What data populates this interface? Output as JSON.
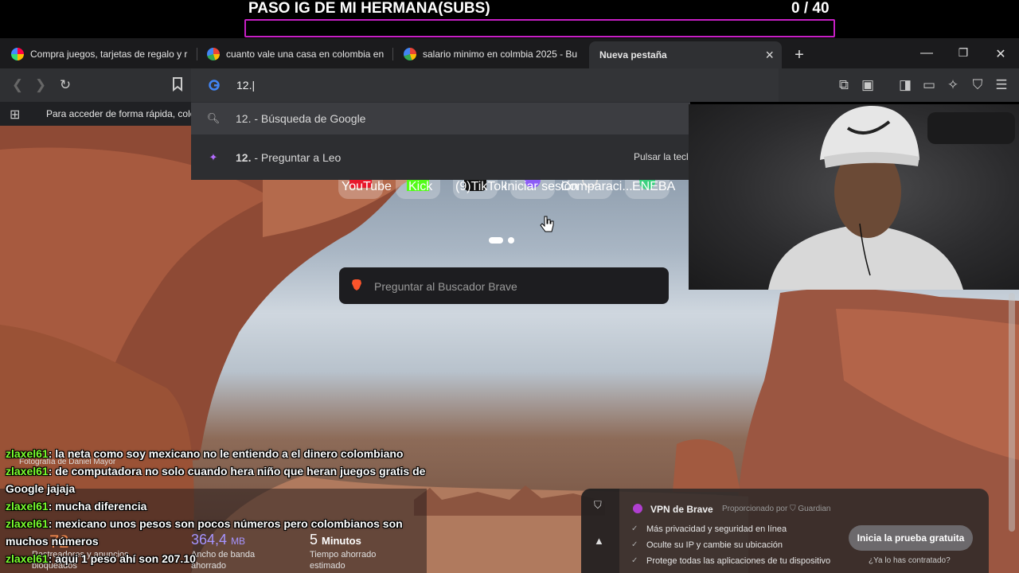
{
  "stream_goal": {
    "title": "PASO IG DE MI HERMANA(SUBS)",
    "count": "0  / 40",
    "progress": 0
  },
  "tabs": [
    {
      "title": "Compra juegos, tarjetas de regalo y r",
      "favicon": "eneba-icon"
    },
    {
      "title": "cuanto vale una casa en colombia en",
      "favicon": "google-icon"
    },
    {
      "title": "salario minimo en colmbia 2025 - Bu",
      "favicon": "google-icon"
    },
    {
      "title": "Nueva pestaña",
      "close": "×",
      "active": true
    }
  ],
  "new_tab_label": "+",
  "window_controls": {
    "minimize": "—",
    "restore": "❐",
    "close": "✕"
  },
  "omnibox": {
    "text": "12.|"
  },
  "bookmark_bar": {
    "text": "Para acceder de forma rápida, colo"
  },
  "suggestions": [
    {
      "bold": "12.",
      "rest": " - Búsqueda de Google",
      "icon": "search-icon"
    },
    {
      "bold": "12.",
      "rest": " - Preguntar a Leo",
      "icon": "leo-icon",
      "hint": "Pulsar la tecla"
    }
  ],
  "top_sites": [
    {
      "label": "YouTube",
      "color": "#e8172b"
    },
    {
      "label": "Kick",
      "color": "#53fc18"
    },
    {
      "label": "(9)TikTok",
      "color": "#111111"
    },
    {
      "label": "Iniciar sesión",
      "color": "#8b5cf6"
    },
    {
      "label": "Comparaci...",
      "color": "#cfcfcf"
    },
    {
      "label": "ENEBA",
      "color": "#3bd17f"
    }
  ],
  "search": {
    "placeholder": "Preguntar al Buscador Brave"
  },
  "photo_credit": "Fotografía de Daniel Mayor",
  "stats": [
    {
      "value": "72",
      "label": "Rastreadores y anuncios bloqueados"
    },
    {
      "value": "364,4",
      "unit": "MB",
      "label": "Ancho de banda ahorrado"
    },
    {
      "value": "5",
      "unit": "Minutos",
      "label": "Tiempo ahorrado estimado"
    }
  ],
  "vpn": {
    "title": "VPN de Brave",
    "provider": "Proporcionado por",
    "provider_name": "Guardian",
    "items": [
      "Más privacidad y seguridad en línea",
      "Oculte su IP y cambie su ubicación",
      "Protege todas las aplicaciones de tu dispositivo"
    ],
    "cta": "Inicia la prueba gratuita",
    "footer": "¿Ya lo has contratado?"
  },
  "chat": [
    {
      "user": "zlaxel61",
      "text": ": la neta como soy mexicano no le entiendo a el dinero colombiano"
    },
    {
      "user": "zlaxel61",
      "text": ": de computadora no solo cuando hera niño que heran juegos gratis de"
    },
    {
      "user": "",
      "text": "Google jajaja"
    },
    {
      "user": "zlaxel61",
      "text": ": mucha diferencia"
    },
    {
      "user": "zlaxel61",
      "text": ": mexicano unos pesos son pocos números pero colombianos son"
    },
    {
      "user": "",
      "text": "muchos números"
    },
    {
      "user": "zlaxel61",
      "text": ": aqui 1 peso ahí son 207.10"
    }
  ]
}
